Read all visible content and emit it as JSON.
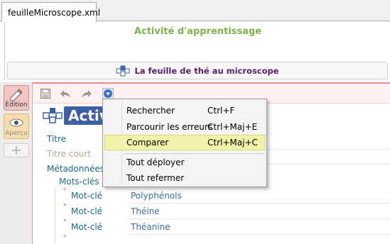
{
  "tab": {
    "label": "feuilleMicroscope.xml"
  },
  "header": {
    "activity_label": "Activité d'apprentissage",
    "doc_title": "La feuille de thé au microscope"
  },
  "sidebar": {
    "edit_label": "Édition",
    "view_label": "Aperçu"
  },
  "editor": {
    "big_title": "Activ",
    "fields": {
      "titre": "Titre",
      "titre_court": "Titre court",
      "metadonnees": "Métadonnées",
      "mots_cles": "Mots-clés",
      "mot_cle_1_label": "Mot-clé",
      "mot_cle_1_value": "Polyphénols",
      "mot_cle_2_label": "Mot-clé",
      "mot_cle_2_value": "Théine",
      "mot_cle_3_label": "Mot-clé",
      "mot_cle_3_value": "Théanine"
    }
  },
  "menu": {
    "items": [
      {
        "label": "Rechercher",
        "shortcut": "Ctrl+F"
      },
      {
        "label": "Parcourir les erreurs",
        "shortcut": "Ctrl+Maj+E"
      },
      {
        "label": "Comparer",
        "shortcut": "Ctrl+Maj+C"
      },
      {
        "label": "Tout déployer",
        "shortcut": ""
      },
      {
        "label": "Tout refermer",
        "shortcut": ""
      }
    ]
  },
  "colors": {
    "activity_green": "#7fb24a",
    "doc_title_purple": "#5b1e6e",
    "menu_highlight": "#f2f2a8",
    "editor_accent": "#e88888"
  },
  "icons": [
    "document-structure-icon",
    "pencil-icon",
    "eye-icon",
    "puzzle-icon",
    "save-icon",
    "undo-icon",
    "redo-icon",
    "dropdown-menu-icon"
  ]
}
